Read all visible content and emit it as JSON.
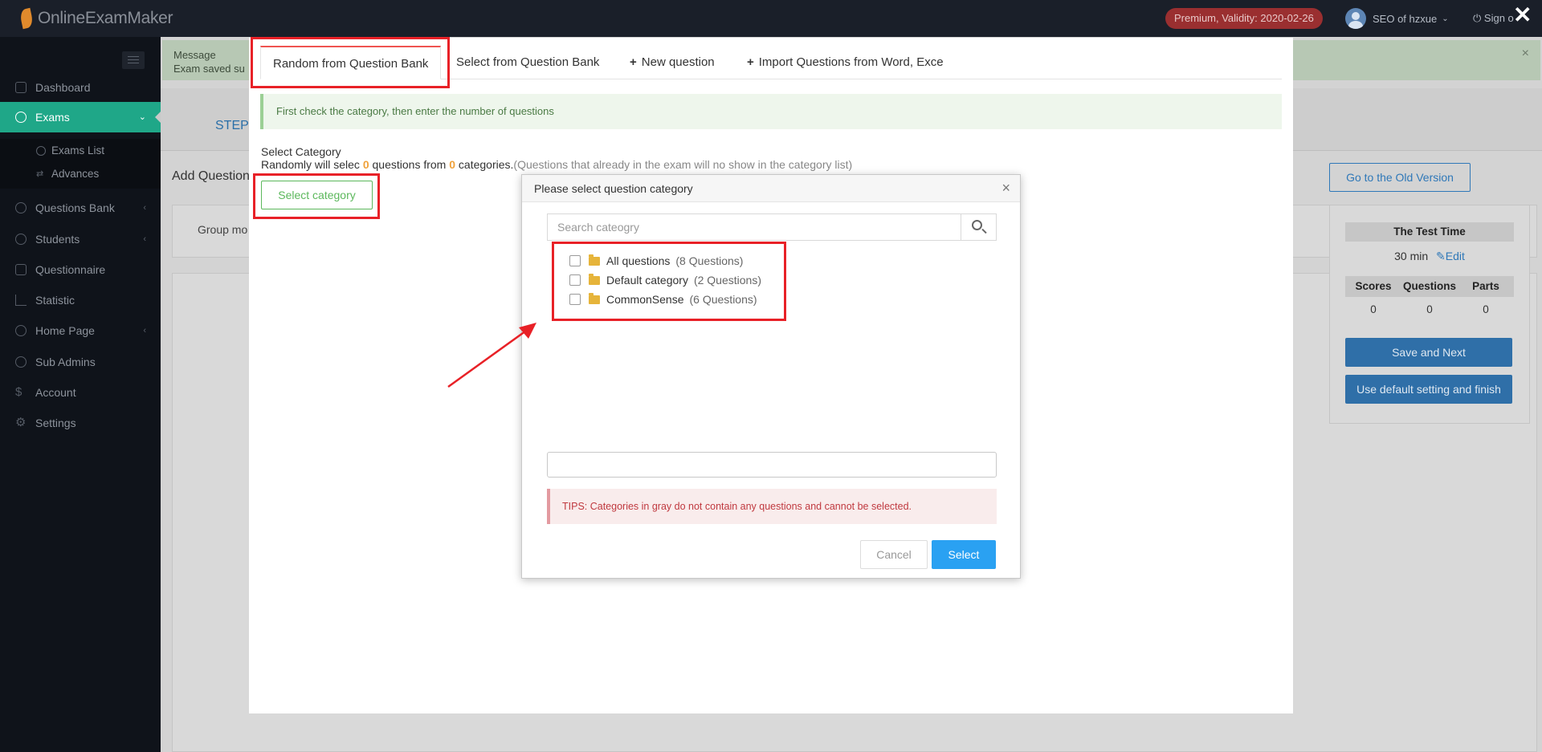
{
  "topbar": {
    "brand": "OnlineExamMaker",
    "premium_badge": "Premium, Validity: 2020-02-26",
    "user_name": "SEO of hzxue",
    "signout": "Sign o",
    "premium_color": "#9a2f30",
    "bg_color": "#1a1f29"
  },
  "sidebar": {
    "accent_color": "#1fa788",
    "items": [
      {
        "label": "Dashboard",
        "icon": "home-icon"
      },
      {
        "label": "Exams",
        "icon": "check-circle-icon",
        "active": true
      },
      {
        "label": "Questions Bank",
        "icon": "question-icon"
      },
      {
        "label": "Students",
        "icon": "users-icon"
      },
      {
        "label": "Questionnaire",
        "icon": "checkbox-icon"
      },
      {
        "label": "Statistic",
        "icon": "bar-chart-icon"
      },
      {
        "label": "Home Page",
        "icon": "globe-icon"
      },
      {
        "label": "Sub Admins",
        "icon": "question-circle-icon"
      },
      {
        "label": "Account",
        "icon": "dollar-icon"
      },
      {
        "label": "Settings",
        "icon": "gear-icon"
      }
    ],
    "subitems": [
      {
        "label": "Exams List",
        "icon": "check-circle-icon"
      },
      {
        "label": "Advances",
        "icon": "shuffle-icon"
      }
    ]
  },
  "background": {
    "message_title": "Message",
    "message_body": "Exam saved su",
    "step_label": "STEP",
    "add_question": "Add Question",
    "group_mode": "Group mo",
    "old_version_button": "Go to the Old Version",
    "test_time_header": "The Test Time",
    "test_time_value": "30 min",
    "edit_link": "Edit",
    "stat_headers": [
      "Scores",
      "Questions",
      "Parts"
    ],
    "stat_values": [
      "0",
      "0",
      "0"
    ],
    "save_next_button": "Save and Next",
    "default_finish_button": "Use default setting and finish"
  },
  "modal": {
    "tabs": [
      {
        "label": "Random from Question Bank",
        "active": true
      },
      {
        "label": "Select from Question Bank"
      },
      {
        "label": "New question",
        "icon": "plus-icon"
      },
      {
        "label": "Import Questions from Word, Exce",
        "icon": "plus-icon"
      }
    ],
    "info_text": "First check the category, then enter the number of questions",
    "select_category_label": "Select Category",
    "randomly_prefix": "Randomly will selec",
    "question_count": "0",
    "questions_from": "questions from",
    "category_count": "0",
    "categories_word": "categories.",
    "randomly_note": "(Questions that already in the exam will no show in the category list)",
    "select_category_button": "Select category"
  },
  "dialog": {
    "title": "Please select question category",
    "search_placeholder": "Search cateogry",
    "categories": [
      {
        "name": "All questions",
        "count": "(8  Questions)"
      },
      {
        "name": "Default category",
        "count": "(2  Questions)"
      },
      {
        "name": "CommonSense",
        "count": "(6  Questions)"
      }
    ],
    "tips": "TIPS: Categories in gray do not contain any questions and cannot be selected.",
    "cancel_button": "Cancel",
    "select_button": "Select",
    "select_color": "#2aa1f2"
  },
  "annotations": {
    "highlight_color": "#e82127"
  }
}
